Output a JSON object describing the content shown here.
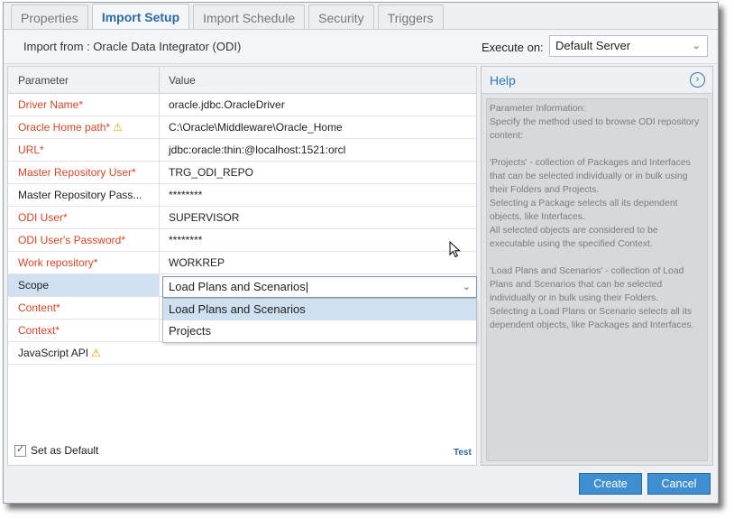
{
  "tabs": [
    "Properties",
    "Import Setup",
    "Import Schedule",
    "Security",
    "Triggers"
  ],
  "active_tab": "Import Setup",
  "import": {
    "from_label": "Import from : Oracle Data Integrator (ODI)",
    "execute_label": "Execute on:",
    "execute_value": "Default Server"
  },
  "table": {
    "col_parameter": "Parameter",
    "col_value": "Value",
    "rows": [
      {
        "name": "Driver Name*",
        "value": "oracle.jdbc.OracleDriver"
      },
      {
        "name": "Oracle Home path*",
        "value": "C:\\Oracle\\Middleware\\Oracle_Home"
      },
      {
        "name": "URL*",
        "value": "jdbc:oracle:thin:@localhost:1521:orcl"
      },
      {
        "name": "Master Repository User*",
        "value": "TRG_ODI_REPO"
      },
      {
        "name": "Master Repository Pass...",
        "value": "********"
      },
      {
        "name": "ODI User*",
        "value": "SUPERVISOR"
      },
      {
        "name": "ODI User's Password*",
        "value": "********"
      },
      {
        "name": "Work repository*",
        "value": "WORKREP"
      },
      {
        "name": "Scope",
        "value": ""
      },
      {
        "name": "Content*",
        "value": ""
      },
      {
        "name": "Context*",
        "value": ""
      },
      {
        "name": "JavaScript API",
        "value": ""
      }
    ]
  },
  "scope": {
    "value": "Load Plans and Scenarios",
    "options": [
      "Load Plans and Scenarios",
      "Projects"
    ]
  },
  "set_default_label": "Set as Default",
  "test_label": "Test",
  "help": {
    "title": "Help",
    "body": "Parameter Information:\nSpecify the method used to browse ODI repository content:\n\n'Projects' - collection of Packages and Interfaces that can be selected individually or in bulk using their Folders and Projects.\nSelecting a Package selects all its dependent objects, like Interfaces.\nAll selected objects are considered to be executable using the specified Context.\n\n'Load Plans and Scenarios' - collection of Load Plans and Scenarios that can be selected individually or in bulk using their Folders.\nSelecting a Load Plans or Scenario selects all its dependent objects, like Packages and Interfaces."
  },
  "buttons": {
    "create": "Create",
    "cancel": "Cancel"
  },
  "colors": {
    "required": "#d24726",
    "accent": "#2b78b8",
    "button": "#3f8fd0",
    "selection": "#cfe0f1"
  }
}
